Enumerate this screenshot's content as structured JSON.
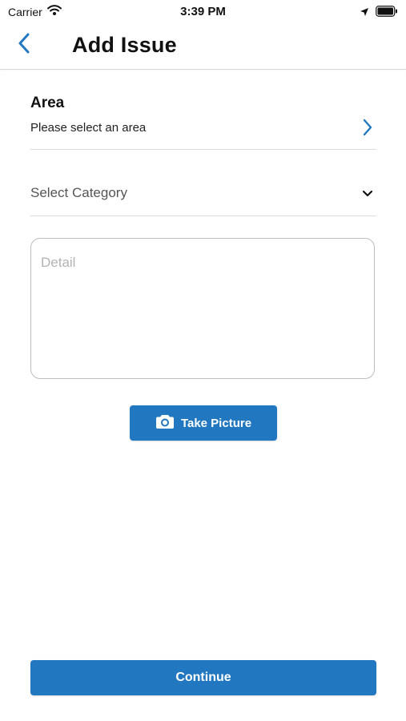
{
  "status_bar": {
    "carrier": "Carrier",
    "time": "3:39 PM",
    "wifi_icon": "wifi-icon",
    "location_icon": "location-arrow-icon",
    "battery_icon": "battery-icon"
  },
  "nav": {
    "title": "Add Issue",
    "back_icon": "chevron-left-icon"
  },
  "area": {
    "title": "Area",
    "value": "Please select an area",
    "chevron_icon": "chevron-right-icon"
  },
  "category": {
    "placeholder": "Select Category",
    "chevron_icon": "chevron-down-icon"
  },
  "detail": {
    "placeholder": "Detail",
    "value": ""
  },
  "take_picture": {
    "label": "Take Picture",
    "icon": "camera-icon"
  },
  "continue": {
    "label": "Continue"
  },
  "colors": {
    "accent": "#2277c1",
    "divider": "#dcdcdc",
    "placeholder": "#b3b3b3"
  }
}
